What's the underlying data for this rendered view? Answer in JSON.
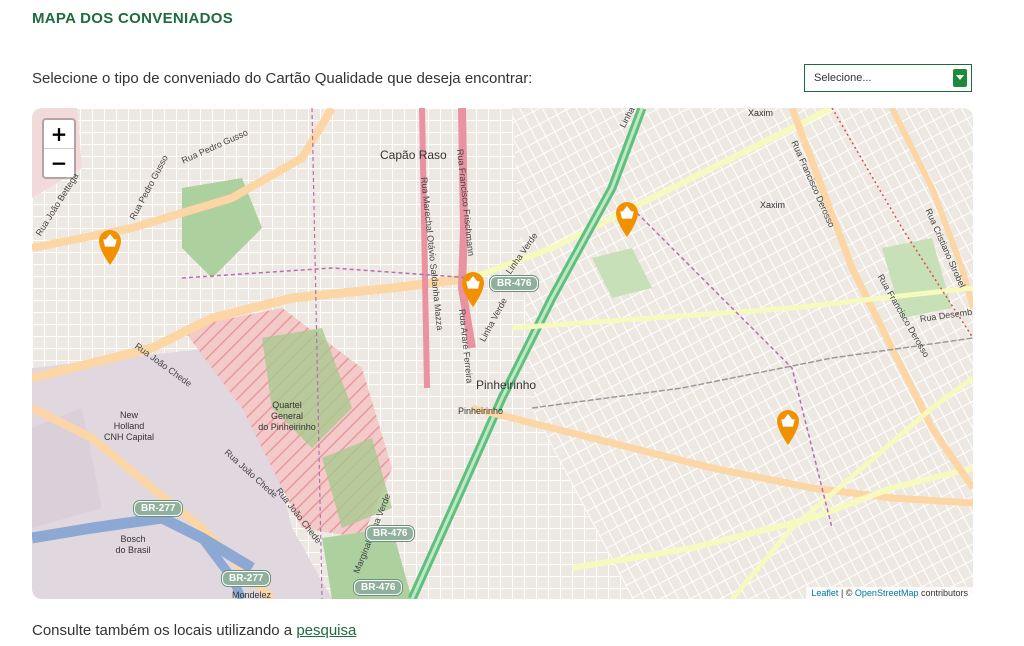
{
  "page": {
    "title": "MAPA DOS CONVENIADOS",
    "prompt": "Selecione o tipo de conveniado do Cartão Qualidade que deseja encontrar:"
  },
  "select": {
    "value": "Selecione..."
  },
  "map": {
    "zoom_in": "+",
    "zoom_out": "−",
    "labels": {
      "capao_raso": "Capão Raso",
      "xaxim": "Xaxim",
      "xaxim_top": "Xaxim",
      "pinheirinho": "Pinheirinho",
      "pinheirinho_small": "Pinheirinho",
      "quartel_1": "Quartel",
      "quartel_2": "General",
      "quartel_3": "do Pinheirinho",
      "newholland_1": "New",
      "newholland_2": "Holland",
      "newholland_3": "CNH Capital",
      "bosch_1": "Bosch",
      "bosch_2": "do Brasil",
      "mondelez": "Mondelez",
      "rua_pedro_gusso": "Rua Pedro Gusso",
      "rua_pedro_gusso_2": "Rua Pedro Gusso",
      "rua_joao_bettega": "Rua João Bettega",
      "rua_joao_chede": "Rua João Chede",
      "rua_joao_chede_2": "Rua João Chede",
      "rua_joao_chede_3": "Rua João Chede",
      "linha_verde": "Linha Verde",
      "linha_verde_2": "Linha Verde",
      "marginal_linha_verde": "Marginal Linha Verde",
      "rua_francisco_derosso": "Rua Francisco Derosso",
      "rua_francisco_derosso_2": "Rua Francisco Derosso",
      "rua_cristiano_strobel": "Rua Cristiano Strobel",
      "rua_desembargador": "Rua Desemb",
      "rua_marechal": "Rua Marechal Otávio Saldanha Mazza",
      "rua_francisco_frischmann": "Rua Francisco Frischmann",
      "rua_arare": "Rua Arare Ferreira",
      "linha_top": "Linha"
    },
    "shields": {
      "br476_a": "BR-476",
      "br476_b": "BR-476",
      "br476_c": "BR-476",
      "br277_a": "BR-277",
      "br277_b": "BR-277"
    },
    "markers": [
      {
        "name": "marker-1",
        "icon": "basket-marker-icon"
      },
      {
        "name": "marker-2",
        "icon": "basket-marker-icon"
      },
      {
        "name": "marker-3",
        "icon": "basket-marker-icon"
      },
      {
        "name": "marker-4",
        "icon": "basket-marker-icon"
      }
    ],
    "attribution": {
      "leaflet": "Leaflet",
      "separator": " | © ",
      "osm": "OpenStreetMap",
      "suffix": " contributors"
    }
  },
  "footer": {
    "text": "Consulte também os locais utilizando a ",
    "link": "pesquisa"
  },
  "colors": {
    "brand_green": "#1e6b3c",
    "marker_orange": "#f29100",
    "map_bg": "#f2efe9"
  }
}
